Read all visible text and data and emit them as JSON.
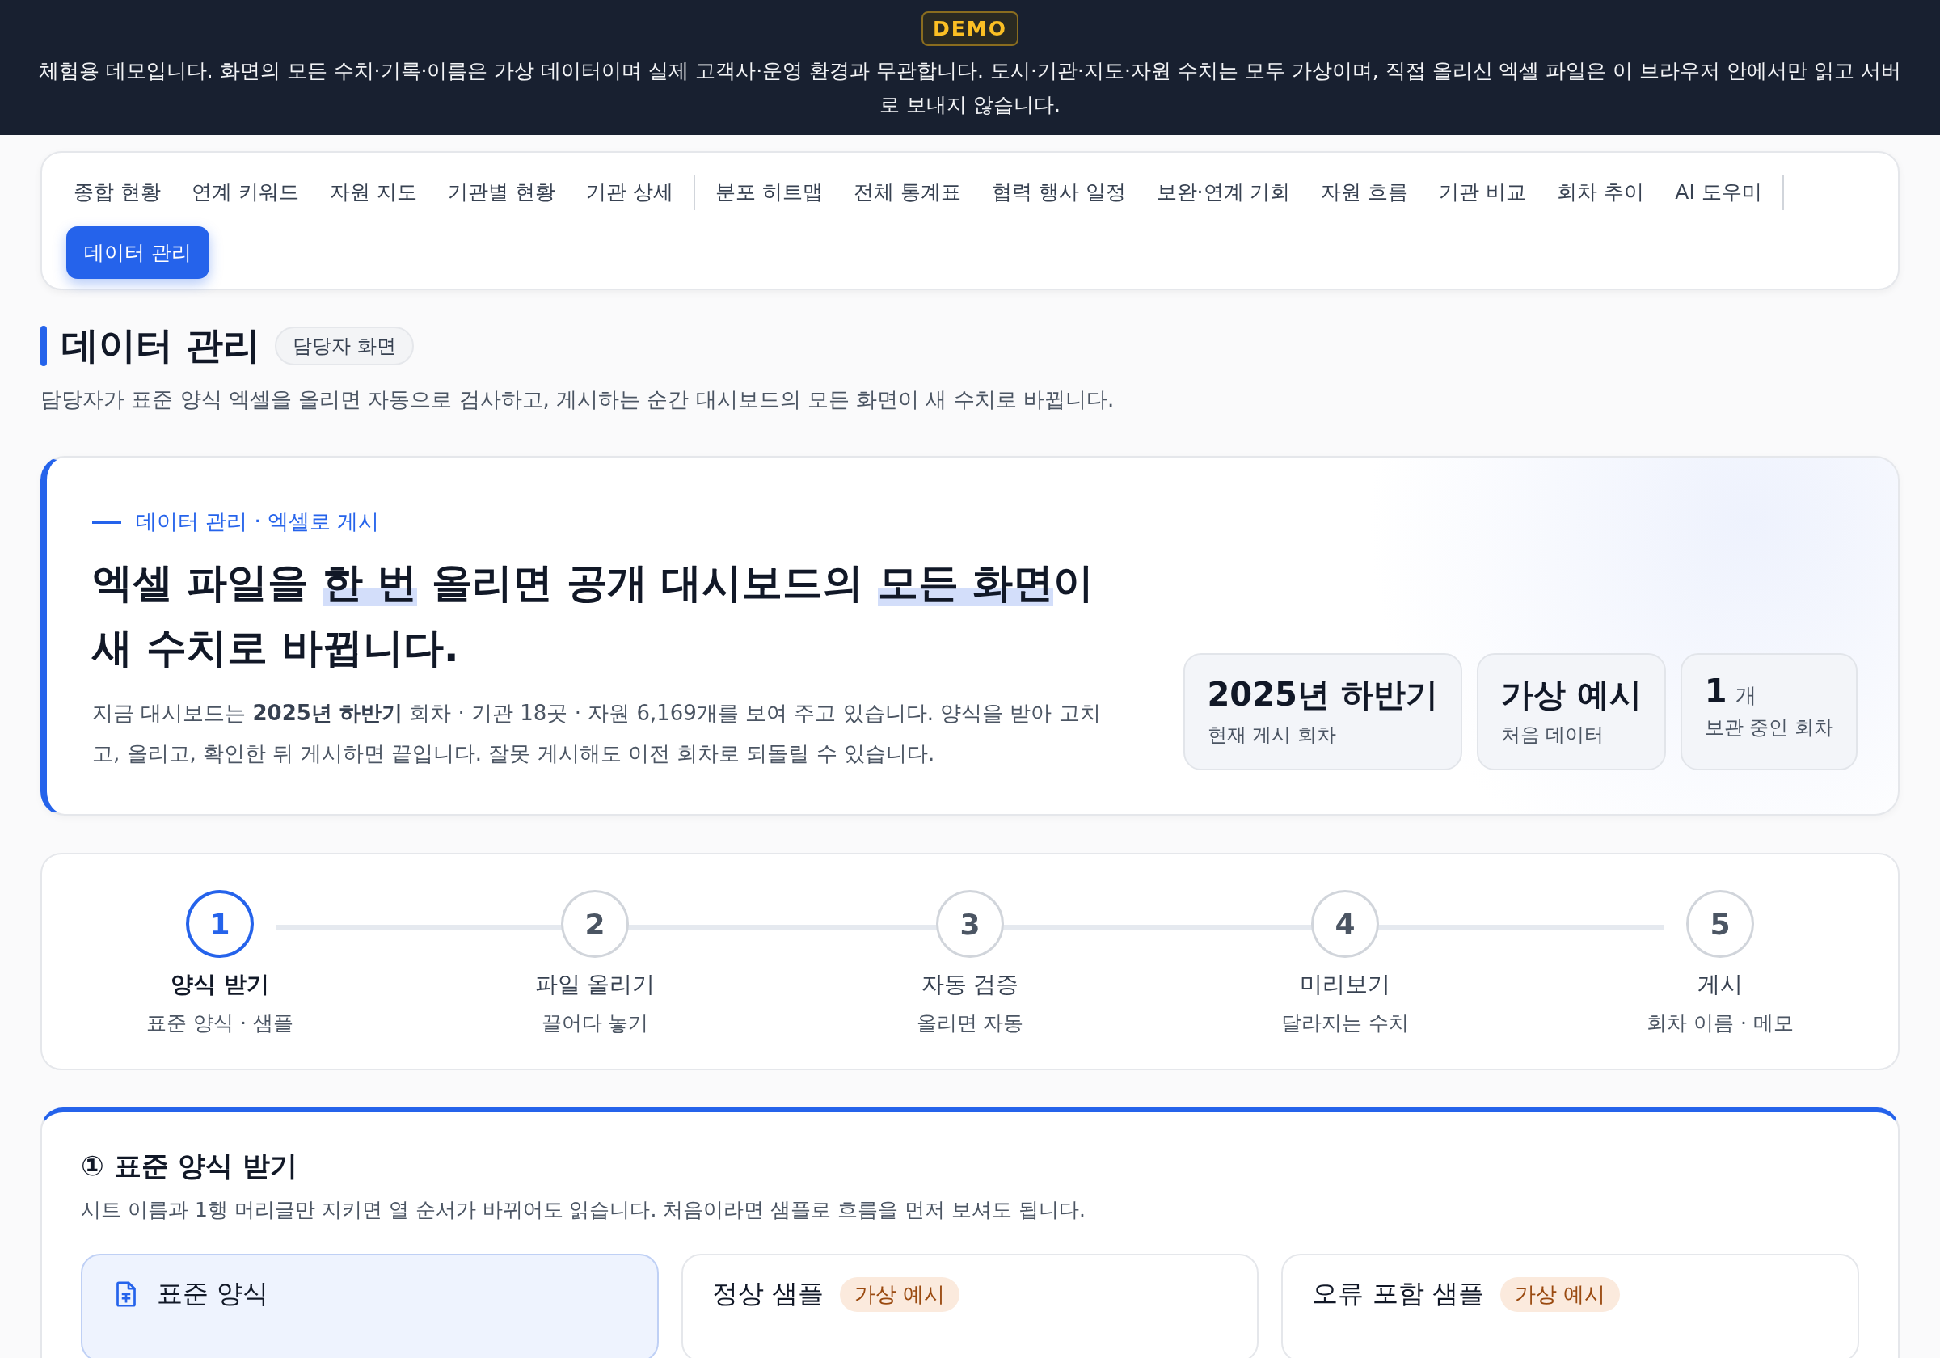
{
  "banner": {
    "badge": "DEMO",
    "text": "체험용 데모입니다. 화면의 모든 수치·기록·이름은 가상 데이터이며 실제 고객사·운영 환경과 무관합니다. 도시·기관·지도·자원 수치는 모두 가상이며, 직접 올리신 엑셀 파일은 이 브라우저 안에서만 읽고 서버로 보내지 않습니다."
  },
  "nav": {
    "groups": [
      [
        {
          "label": "종합 현황",
          "selected": false
        },
        {
          "label": "연계 키워드",
          "selected": false
        },
        {
          "label": "자원 지도",
          "selected": false
        },
        {
          "label": "기관별 현황",
          "selected": false
        },
        {
          "label": "기관 상세",
          "selected": false
        }
      ],
      [
        {
          "label": "분포 히트맵",
          "selected": false
        },
        {
          "label": "전체 통계표",
          "selected": false
        },
        {
          "label": "협력 행사 일정",
          "selected": false
        },
        {
          "label": "보완·연계 기회",
          "selected": false
        },
        {
          "label": "자원 흐름",
          "selected": false
        },
        {
          "label": "기관 비교",
          "selected": false
        },
        {
          "label": "회차 추이",
          "selected": false
        },
        {
          "label": "AI 도우미",
          "selected": false
        }
      ],
      [
        {
          "label": "데이터 관리",
          "selected": true
        }
      ]
    ]
  },
  "page": {
    "title": "데이터 관리",
    "badge": "담당자 화면",
    "description": "담당자가 표준 양식 엑셀을 올리면 자동으로 검사하고, 게시하는 순간 대시보드의 모든 화면이 새 수치로 바뀝니다."
  },
  "hero": {
    "eyebrow": "데이터 관리 · 엑셀로 게시",
    "headline": [
      {
        "text": "엑셀 파일을 ",
        "highlight": false
      },
      {
        "text": "한 번",
        "highlight": true
      },
      {
        "text": " 올리면 공개 대시보드의 ",
        "highlight": false
      },
      {
        "text": "모든 화면",
        "highlight": true
      },
      {
        "text": "이 새 수치로 바뀝니다.",
        "highlight": false
      }
    ],
    "body": "지금 대시보드는 **2025년 하반기** 회차 · 기관 18곳 · 자원 6,169개를 보여 주고 있습니다. 양식을 받아 고치고, 올리고, 확인한 뒤 게시하면 끝입니다. 잘못 게시해도 이전 회차로 되돌릴 수 있습니다.",
    "stats": [
      {
        "value": "2025년 하반기",
        "label": "현재 게시 회차"
      },
      {
        "value": "가상 예시",
        "label": "처음 데이터"
      },
      {
        "value": "1",
        "unit": "개",
        "label": "보관 중인 회차"
      }
    ]
  },
  "steps": [
    {
      "number": "1",
      "title": "양식 받기",
      "subtitle": "표준 양식 · 샘플",
      "selected": true
    },
    {
      "number": "2",
      "title": "파일 올리기",
      "subtitle": "끌어다 놓기",
      "selected": false
    },
    {
      "number": "3",
      "title": "자동 검증",
      "subtitle": "올리면 자동",
      "selected": false
    },
    {
      "number": "4",
      "title": "미리보기",
      "subtitle": "달라지는 수치",
      "selected": false
    },
    {
      "number": "5",
      "title": "게시",
      "subtitle": "회차 이름 · 메모",
      "selected": false
    }
  ],
  "section": {
    "title": "① 표준 양식 받기",
    "description": "시트 이름과 1행 머리글만 지키면 열 순서가 바뀌어도 읽습니다. 처음이라면 샘플로 흐름을 먼저 보셔도 됩니다.",
    "cards": [
      {
        "kind": "template",
        "title": "표준 양식",
        "selected": true
      },
      {
        "kind": "sample",
        "title": "정상 샘플",
        "tag": "가상 예시",
        "selected": false
      },
      {
        "kind": "sample",
        "title": "오류 포함 샘플",
        "tag": "가상 예시",
        "selected": false
      }
    ]
  }
}
